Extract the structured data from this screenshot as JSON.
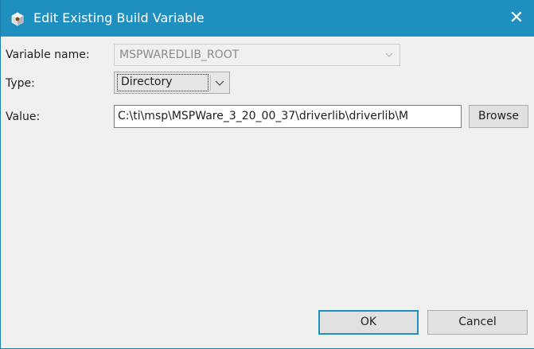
{
  "window": {
    "title": "Edit Existing Build Variable",
    "close_glyph": "✕",
    "title_icon": "gear-cube-icon",
    "accent_color": "#1f8fbf"
  },
  "form": {
    "variable_name": {
      "label": "Variable name:",
      "value": "MSPWAREDLIB_ROOT",
      "disabled": true
    },
    "type": {
      "label": "Type:",
      "selected": "Directory"
    },
    "value": {
      "label": "Value:",
      "text": "C:\\ti\\msp\\MSPWare_3_20_00_37\\driverlib\\driverlib\\M"
    }
  },
  "buttons": {
    "browse": "Browse",
    "ok": "OK",
    "cancel": "Cancel"
  }
}
